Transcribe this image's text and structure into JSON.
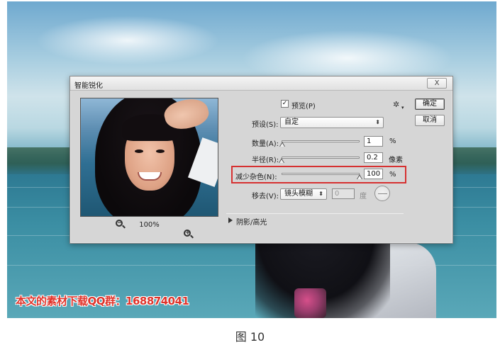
{
  "dialog": {
    "title": "智能锐化",
    "close_label": "X",
    "preview_checkbox_label": "预览(P)",
    "preview_checked": true,
    "ok_label": "确定",
    "cancel_label": "取消",
    "preset_label": "预设(S):",
    "preset_value": "自定",
    "amount_label": "数量(A):",
    "amount_value": "1",
    "amount_unit": "%",
    "radius_label": "半径(R):",
    "radius_value": "0.2",
    "radius_unit": "像素",
    "noise_label": "减少杂色(N):",
    "noise_value": "100",
    "noise_unit": "%",
    "remove_label": "移去(V):",
    "remove_value": "镜头模糊",
    "angle_value": "0",
    "angle_unit": "度",
    "shadows_label": "阴影/高光",
    "zoom_value": "100%"
  },
  "slider_levels": {
    "amount": 0.01,
    "radius": 0.0,
    "noise": 1.0
  },
  "watermark": "本文的素材下载QQ群：168874041",
  "caption": "图 10",
  "colors": {
    "highlight_box": "#d63131",
    "watermark": "#e0342b"
  },
  "icons": [
    "zoom-out-icon",
    "zoom-in-icon",
    "gear-icon",
    "disclosure-triangle-icon",
    "angle-dial-icon",
    "chevron-down-icon"
  ]
}
